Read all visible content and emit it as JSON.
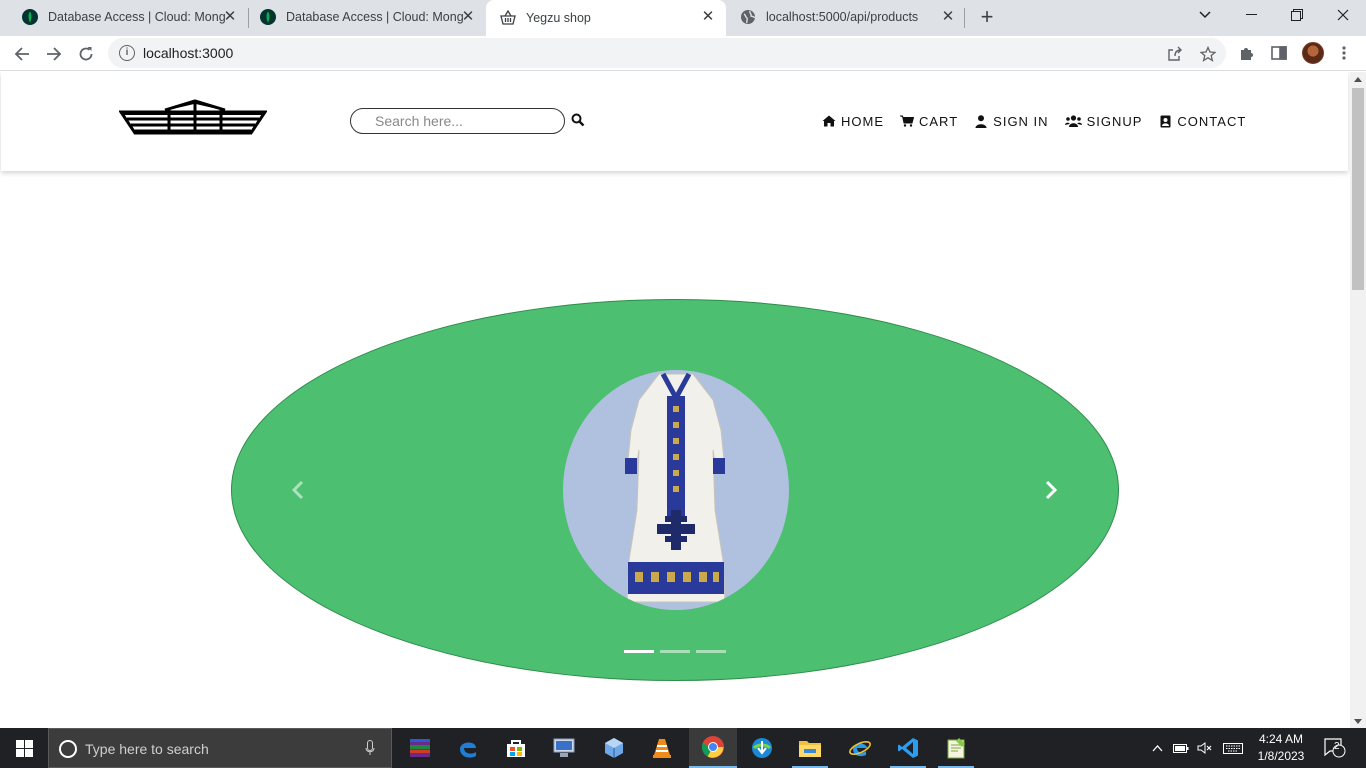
{
  "browser": {
    "tabs": [
      {
        "title": "Database Access | Cloud: MongoDB Cloud",
        "icon": "mongodb-leaf-icon"
      },
      {
        "title": "Database Access | Cloud: MongoDB Cloud",
        "icon": "mongodb-leaf-icon"
      },
      {
        "title": "Yegzu shop",
        "icon": "shopping-basket-icon",
        "active": true
      },
      {
        "title": "localhost:5000/api/products",
        "icon": "globe-icon"
      }
    ],
    "url": "localhost:3000"
  },
  "site": {
    "search_placeholder": "Search here...",
    "nav": [
      {
        "label": "HOME",
        "icon": "home-icon"
      },
      {
        "label": "CART",
        "icon": "cart-icon"
      },
      {
        "label": "SIGN IN",
        "icon": "user-icon"
      },
      {
        "label": "SIGNUP",
        "icon": "users-icon"
      },
      {
        "label": "CONTACT",
        "icon": "contact-card-icon"
      }
    ],
    "carousel": {
      "slides": 3,
      "active_index": 0,
      "slide_image": "white-traditional-dress-with-blue-embroidery"
    }
  },
  "taskbar": {
    "search_placeholder": "Type here to search",
    "time": "4:24 AM",
    "date": "1/8/2023",
    "notification_count": "2"
  },
  "colors": {
    "hero_green": "#4cbf71",
    "product_bg": "#b0c1df",
    "dress_blue": "#2a3a9a"
  }
}
